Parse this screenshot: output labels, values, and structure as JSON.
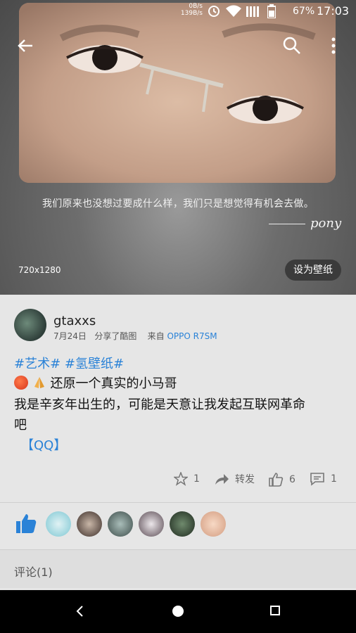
{
  "status_bar": {
    "speed_up": "0B/s",
    "speed_down": "139B/s",
    "battery_pct": "67%",
    "time": "17:03"
  },
  "hero": {
    "quote": "我们原来也没想过要成什么样，我们只是想觉得有机会去做。",
    "signature": "pony",
    "resolution": "720x1280",
    "set_wallpaper_label": "设为壁纸"
  },
  "post": {
    "username": "gtaxxs",
    "date": "7月24日",
    "shared": "分享了酷图",
    "from_label": "来自",
    "device": "OPPO R7SM",
    "tags": "#艺术# #氢壁纸#",
    "line1": "还原一个真实的小马哥",
    "line2": "我是辛亥年出生的，可能是天意让我发起互联网革命",
    "line3": "吧",
    "qq_link": "【QQ】",
    "actions": {
      "favorite_count": "1",
      "forward_label": "转发",
      "like_count": "6",
      "comment_count": "1"
    }
  },
  "comments": {
    "title": "评论(1)"
  },
  "icons": [
    "back-arrow-icon",
    "search-icon",
    "more-vertical-icon",
    "star-icon",
    "forward-icon",
    "thumb-up-icon",
    "comment-icon",
    "nav-back-icon",
    "nav-home-icon",
    "nav-recent-icon",
    "wifi-icon",
    "signal-icon",
    "battery-icon"
  ],
  "colors": {
    "link_blue": "#2a82d7",
    "navbar_black": "#000000"
  }
}
